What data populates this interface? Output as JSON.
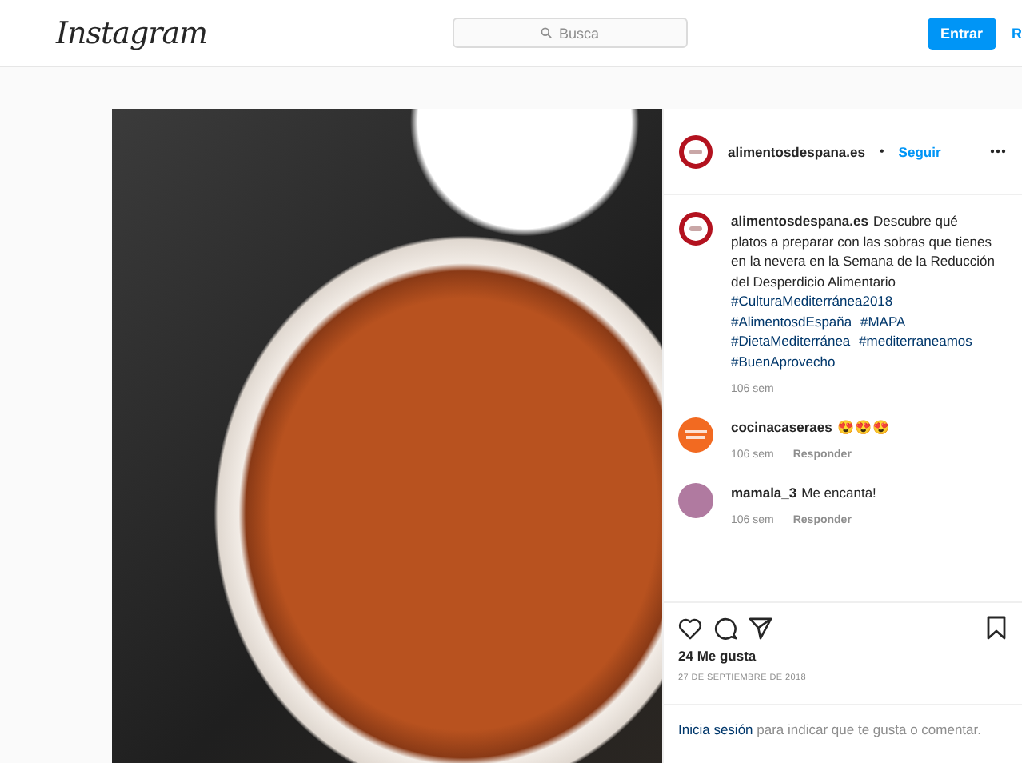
{
  "header": {
    "logo": "Instagram",
    "search": {
      "placeholder": "Busca"
    },
    "login_button": "Entrar",
    "register_link": "R"
  },
  "post": {
    "author": {
      "username": "alimentosdespana.es",
      "separator": "•",
      "follow": "Seguir"
    },
    "caption": {
      "username": "alimentosdespana.es",
      "text": "Descubre qué platos a preparar con las sobras que tienes en la nevera en la Semana de la Reducción del Desperdicio Alimentario",
      "hashtags": [
        "#CulturaMediterránea2018",
        "#AlimentosdEspaña",
        "#MAPA",
        "#DietaMediterránea",
        "#mediterraneamos",
        "#BuenAprovecho"
      ],
      "time": "106 sem"
    },
    "comments": [
      {
        "kind": "brand",
        "username": "cocinacaseraes",
        "text": "😍😍😍",
        "time": "106 sem",
        "reply": "Responder"
      },
      {
        "kind": "person",
        "username": "mamala_3",
        "text": "Me encanta!",
        "time": "106 sem",
        "reply": "Responder"
      }
    ],
    "likes": "24 Me gusta",
    "date": "27 DE SEPTIEMBRE DE 2018",
    "login_prompt": {
      "link": "Inicia sesión",
      "text": "para indicar que te gusta o comentar."
    }
  }
}
